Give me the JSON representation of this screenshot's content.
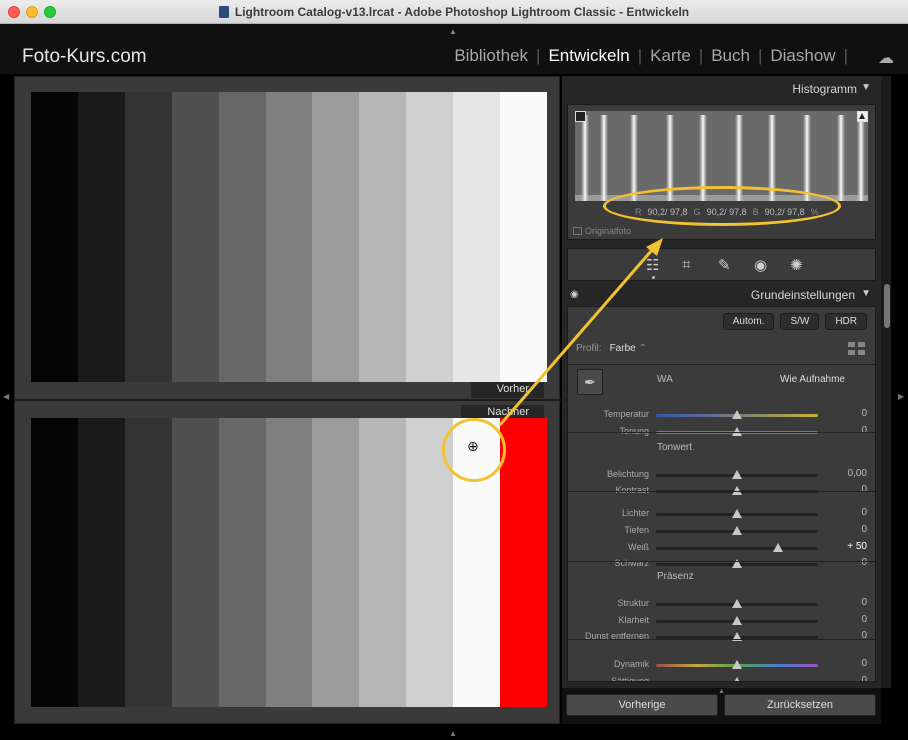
{
  "window": {
    "title": "Lightroom Catalog-v13.lrcat - Adobe Photoshop Lightroom Classic - Entwickeln"
  },
  "topbar": {
    "brand": "Foto-Kurs.com",
    "modules": [
      {
        "label": "Bibliothek",
        "active": false
      },
      {
        "label": "Entwickeln",
        "active": true
      },
      {
        "label": "Karte",
        "active": false
      },
      {
        "label": "Buch",
        "active": false
      },
      {
        "label": "Diashow",
        "active": false
      }
    ],
    "separator": "|"
  },
  "viewer": {
    "before_label": "Vorher",
    "after_label": "Nachher",
    "before_strips": [
      "#050505",
      "#1a1a1a",
      "#333333",
      "#505050",
      "#676767",
      "#808080",
      "#9b9b9b",
      "#b5b5b5",
      "#cfcfcf",
      "#e6e6e6",
      "#fafafa"
    ],
    "after_strips": [
      "#050505",
      "#1a1a1a",
      "#333333",
      "#505050",
      "#676767",
      "#808080",
      "#9b9b9b",
      "#b5b5b5",
      "#cfcfcf",
      "#fafafa",
      "#ff0000"
    ]
  },
  "histogram": {
    "title": "Histogramm",
    "readout": {
      "r_label": "R",
      "r_value": "90,2/ 97,8",
      "g_label": "G",
      "g_value": "90,2/ 97,8",
      "b_label": "B",
      "b_value": "90,2/ 97,8",
      "unit": "%"
    },
    "original_photo_label": "Originalfoto"
  },
  "basic": {
    "title": "Grundeinstellungen",
    "buttons": {
      "auto": "Autom.",
      "bw": "S/W",
      "hdr": "HDR"
    },
    "profile_label": "Profil:",
    "profile_value": "Farbe",
    "wa_label": "WA",
    "wa_value": "Wie Aufnahme",
    "sections": {
      "tone": "Tonwert",
      "presence": "Präsenz"
    },
    "sliders": [
      {
        "label": "Temperatur",
        "value": "0",
        "level": 0.5
      },
      {
        "label": "Tonung",
        "value": "0",
        "level": 0.5
      },
      {
        "label": "Belichtung",
        "value": "0,00",
        "level": 0.5
      },
      {
        "label": "Kontrast",
        "value": "0",
        "level": 0.5
      },
      {
        "label": "Lichter",
        "value": "0",
        "level": 0.5
      },
      {
        "label": "Tiefen",
        "value": "0",
        "level": 0.5
      },
      {
        "label": "Weiß",
        "value": "+ 50",
        "level": 0.75
      },
      {
        "label": "Schwarz",
        "value": "0",
        "level": 0.5
      },
      {
        "label": "Struktur",
        "value": "0",
        "level": 0.5
      },
      {
        "label": "Klarheit",
        "value": "0",
        "level": 0.5
      },
      {
        "label": "Dunst entfernen",
        "value": "0",
        "level": 0.5
      },
      {
        "label": "Dynamik",
        "value": "0",
        "level": 0.5
      },
      {
        "label": "Sättigung",
        "value": "0",
        "level": 0.5
      }
    ]
  },
  "bottom": {
    "previous": "Vorherige",
    "reset": "Zurücksetzen"
  },
  "colors": {
    "annotation": "#f2c230",
    "clip_red": "#ff0000"
  },
  "icons": [
    "sliders-icon",
    "crop-icon",
    "healing-brush-icon",
    "red-eye-icon",
    "masking-icon",
    "eyedropper-icon",
    "eye-icon",
    "cloud-icon",
    "zoom-in-icon",
    "grid-icon"
  ]
}
